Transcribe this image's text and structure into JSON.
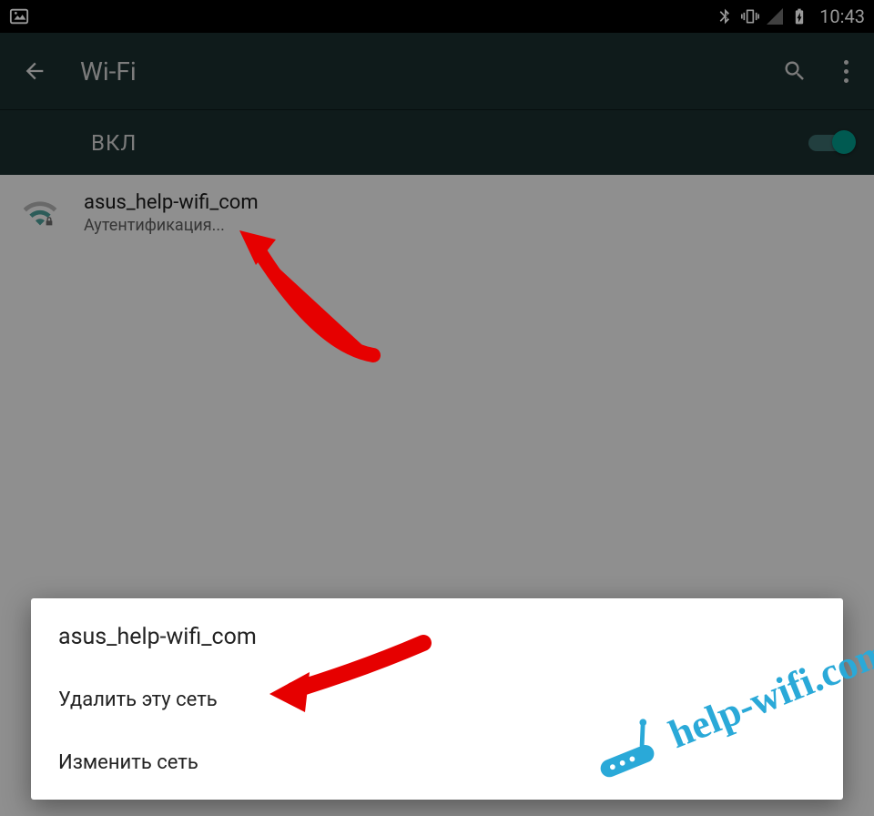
{
  "statusbar": {
    "time": "10:43"
  },
  "header": {
    "title": "Wi-Fi"
  },
  "toggle": {
    "label": "ВКЛ"
  },
  "network": {
    "name": "asus_help-wifi_com",
    "status": "Аутентификация..."
  },
  "dialog": {
    "title": "asus_help-wifi_com",
    "delete": "Удалить эту сеть",
    "edit": "Изменить сеть"
  },
  "watermark": {
    "text": "help-wifi.com"
  }
}
